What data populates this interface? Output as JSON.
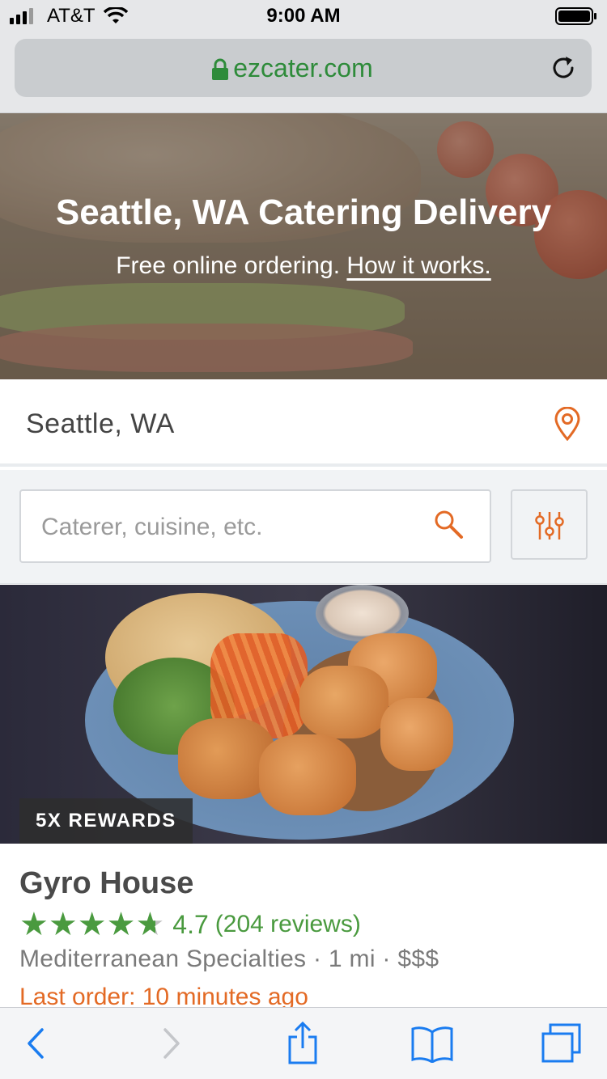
{
  "status_bar": {
    "carrier": "AT&T",
    "time": "9:00 AM",
    "icons": [
      "signal-icon",
      "wifi-icon",
      "battery-icon"
    ]
  },
  "browser": {
    "url": "ezcater.com",
    "icons": [
      "lock-icon",
      "reload-icon"
    ]
  },
  "hero": {
    "title": "Seattle, WA Catering Delivery",
    "subtitle": "Free online ordering.",
    "link": "How it works."
  },
  "location": {
    "value": "Seattle, WA",
    "icon": "location-pin-icon"
  },
  "search": {
    "placeholder": "Caterer, cuisine, etc.",
    "icons": [
      "search-icon",
      "filter-sliders-icon"
    ]
  },
  "listing": {
    "badge": "5X REWARDS",
    "name": "Gyro House",
    "rating": "4.7",
    "stars_filled": 4.7,
    "stars_max": 5,
    "reviews": "(204 reviews)",
    "details": "Mediterranean Specialties · 1 mi · $$$",
    "last_order": "Last order: 10 minutes ago"
  },
  "toolbar": {
    "icons": [
      "back-icon",
      "forward-icon",
      "share-icon",
      "bookmarks-icon",
      "tabs-icon"
    ]
  },
  "colors": {
    "brand_green": "#4a9a3f",
    "url_green": "#2e8b3a",
    "accent_orange": "#e36a25",
    "ios_blue": "#1a7cf0"
  }
}
